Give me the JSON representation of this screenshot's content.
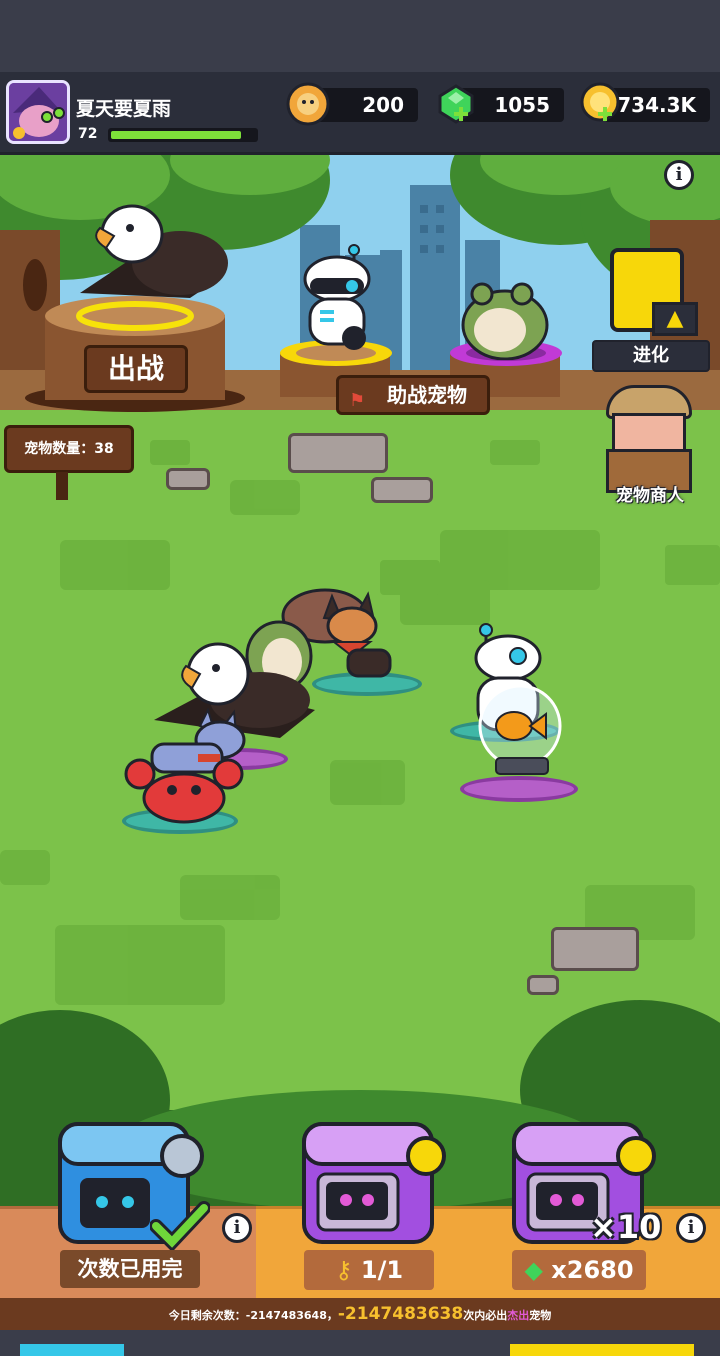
{
  "player": {
    "name": "夏天要夏雨",
    "level": "72",
    "xp_fraction": 0.9
  },
  "resources": {
    "medals": "200",
    "gems": "1055",
    "gold": "734.3K"
  },
  "scene": {
    "deploy_label": "出战",
    "assist_label": "助战宠物",
    "pet_count_label": "宠物数量：38",
    "evolve_label": "进化",
    "merchant_label": "宠物商人",
    "info_glyph": "i"
  },
  "chests": {
    "free": {
      "status": "次数已用完"
    },
    "key": {
      "cost": "1/1"
    },
    "gem": {
      "multiplier": "×10",
      "cost": "x2680"
    },
    "pity": {
      "prefix": "今日剩余次数：-2147483648，",
      "count": "-2147483638",
      "middle": "次内必出",
      "rarity": "杰出",
      "suffix": "宠物"
    }
  },
  "colors": {
    "grass": "#7cc24a",
    "grass_dark": "#6ab03c",
    "hud": "#2b2e3a",
    "accent_green": "#7de03a",
    "wood": "#6b3a1f",
    "gold": "#f7c02e",
    "purple_chest": "#a24fe0",
    "blue_chest": "#2f8fe0"
  }
}
